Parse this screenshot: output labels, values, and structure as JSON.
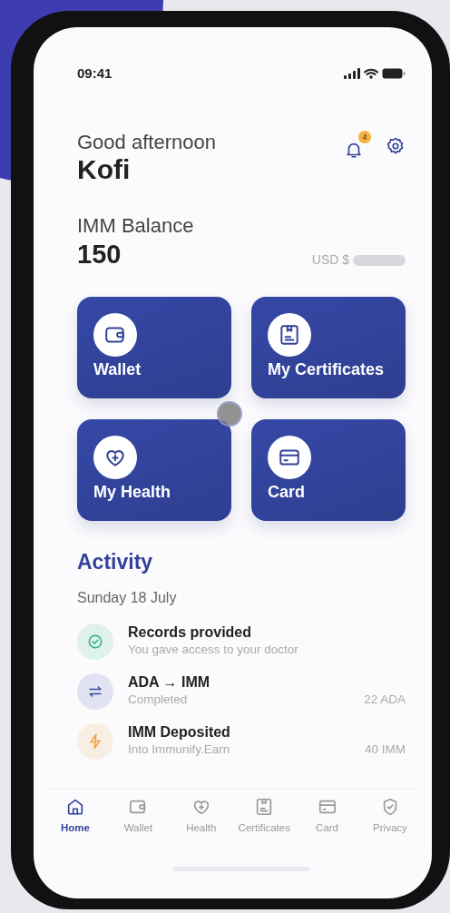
{
  "status_bar": {
    "time": "09:41"
  },
  "header": {
    "greeting": "Good afternoon",
    "name": "Kofi",
    "notification_count": "4"
  },
  "balance": {
    "label": "IMM Balance",
    "value": "150",
    "fiat_label": "USD $"
  },
  "tiles": [
    {
      "kind": "wallet",
      "label": "Wallet"
    },
    {
      "kind": "certificate",
      "label": "My Certificates"
    },
    {
      "kind": "health",
      "label": "My Health"
    },
    {
      "kind": "card",
      "label": "Card"
    }
  ],
  "activity": {
    "title": "Activity",
    "date": "Sunday 18 July",
    "items": [
      {
        "kind": "check",
        "color": "#2eb27a",
        "title": "Records provided",
        "subtitle": "You gave access to your doctor"
      },
      {
        "kind": "swap",
        "color": "#3a4aa8",
        "title": "ADA → IMM",
        "subtitle": "Completed",
        "amount": "22 ADA"
      },
      {
        "kind": "bolt",
        "color": "#f0a040",
        "title": "IMM Deposited",
        "subtitle": "Into Immunify.Earn",
        "amount": "40 IMM"
      }
    ]
  },
  "tab_bar": [
    {
      "kind": "home",
      "label": "Home",
      "selected": true
    },
    {
      "kind": "wallet",
      "label": "Wallet",
      "selected": false
    },
    {
      "kind": "health",
      "label": "Health",
      "selected": false
    },
    {
      "kind": "certificate",
      "label": "Certificates",
      "selected": false
    },
    {
      "kind": "card",
      "label": "Card",
      "selected": false
    },
    {
      "kind": "privacy",
      "label": "Privacy",
      "selected": false
    }
  ]
}
